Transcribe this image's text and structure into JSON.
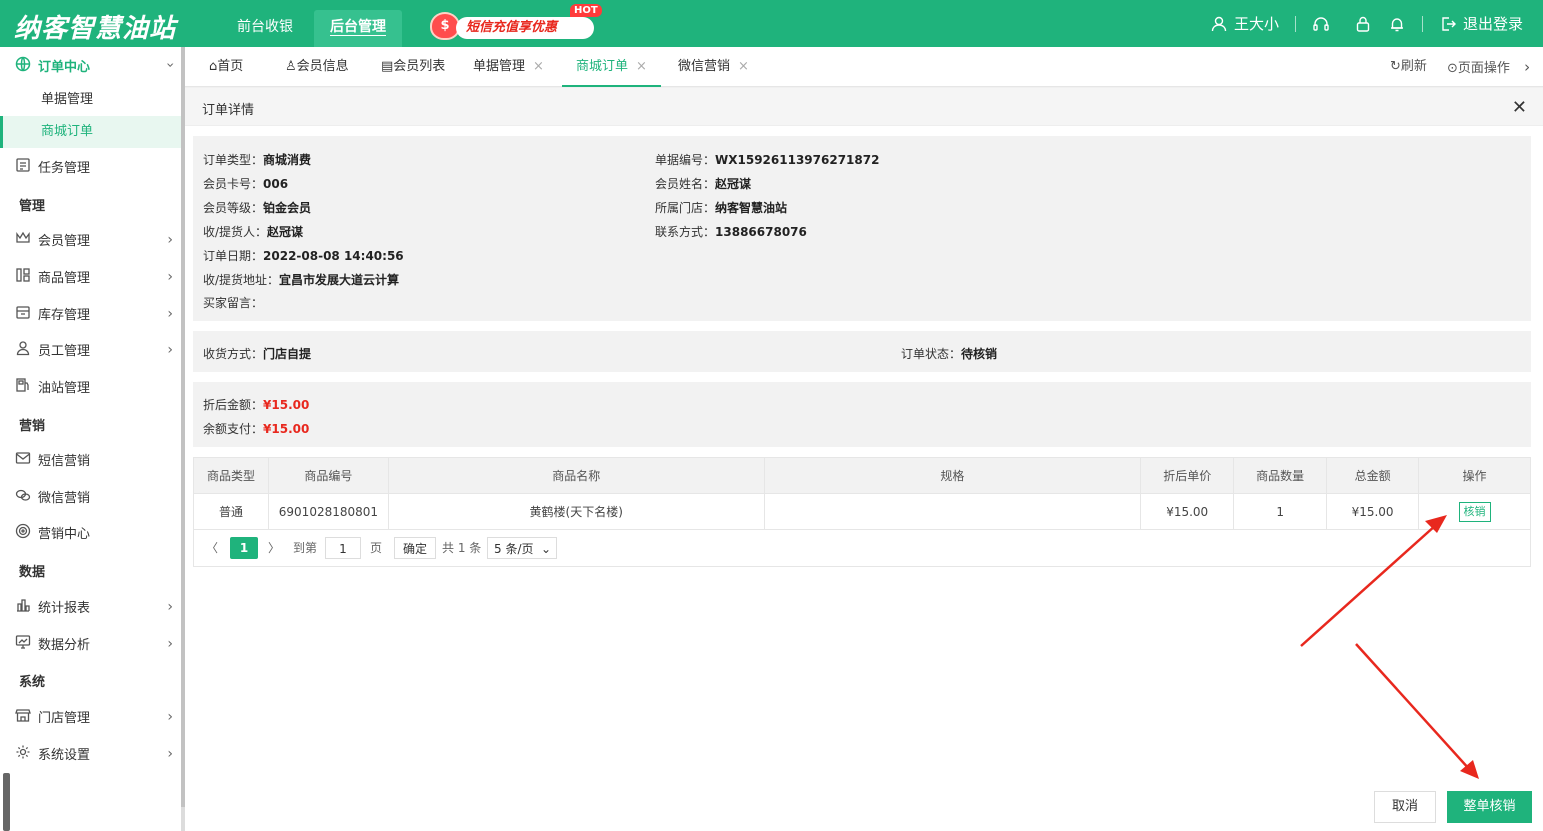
{
  "brand": "纳客智慧油站",
  "topnav": {
    "front": "前台收银",
    "back": "后台管理"
  },
  "promo": {
    "text": "短信充值享优惠",
    "hot": "HOT",
    "bag_glyph": "$"
  },
  "user": {
    "name": "王大小",
    "logout": "退出登录"
  },
  "sidebar": {
    "order_center": "订单中心",
    "sub_items": [
      "单据管理",
      "商城订单"
    ],
    "task": "任务管理",
    "sec_manage": "管理",
    "member": "会员管理",
    "goods": "商品管理",
    "stock": "库存管理",
    "staff": "员工管理",
    "station": "油站管理",
    "sec_marketing": "营销",
    "sms": "短信营销",
    "wechat": "微信营销",
    "marketing_center": "营销中心",
    "sec_data": "数据",
    "report": "统计报表",
    "analysis": "数据分析",
    "sec_system": "系统",
    "store": "门店管理",
    "settings": "系统设置"
  },
  "tabs": {
    "home": "首页",
    "member_info": "会员信息",
    "member_list": "会员列表",
    "bills": "单据管理",
    "mall_orders": "商城订单",
    "wechat_marketing": "微信营销",
    "close_glyph": "×",
    "refresh": "刷新",
    "page_ops": "页面操作"
  },
  "panel": {
    "title": "订单详情",
    "close": "✕"
  },
  "order": {
    "type_label": "订单类型：",
    "type": "商城消费",
    "card_label": "会员卡号：",
    "card": "006",
    "level_label": "会员等级：",
    "level": "铂金会员",
    "receiver_label": "收/提货人：",
    "receiver": "赵冠谋",
    "date_label": "订单日期：",
    "date": "2022-08-08 14:40:56",
    "address_label": "收/提货地址：",
    "address": "宜昌市发展大道云计算",
    "message_label": "买家留言：",
    "message": "",
    "bill_no_label": "单据编号：",
    "bill_no": "WX15926113976271872",
    "member_name_label": "会员姓名：",
    "member_name": "赵冠谋",
    "store_label": "所属门店：",
    "store": "纳客智慧油站",
    "contact_label": "联系方式：",
    "contact": "13886678076",
    "delivery_label": "收货方式：",
    "delivery": "门店自提",
    "status_label": "订单状态：",
    "status": "待核销",
    "discount_label": "折后金额：",
    "discount_amount": "¥15.00",
    "balance_label": "余额支付：",
    "balance_amount": "¥15.00"
  },
  "table": {
    "headers": [
      "商品类型",
      "商品编号",
      "商品名称",
      "规格",
      "折后单价",
      "商品数量",
      "总金额",
      "操作"
    ],
    "row": {
      "type": "普通",
      "code": "6901028180801",
      "name": "黄鹤楼(天下名楼)",
      "spec": "",
      "unit_price": "¥15.00",
      "qty": "1",
      "total": "¥15.00",
      "action": "核销"
    }
  },
  "pager": {
    "prev": "〈",
    "page": "1",
    "next": "〉",
    "goto": "到第",
    "input": "1",
    "page_unit": "页",
    "confirm": "确定",
    "total": "共 1 条",
    "size": "5 条/页"
  },
  "footer": {
    "cancel": "取消",
    "verify_all": "整单核销"
  },
  "colors": {
    "brand_green": "#1fb37c",
    "price_red": "#e8281e",
    "arrow_red": "#e8281e"
  }
}
